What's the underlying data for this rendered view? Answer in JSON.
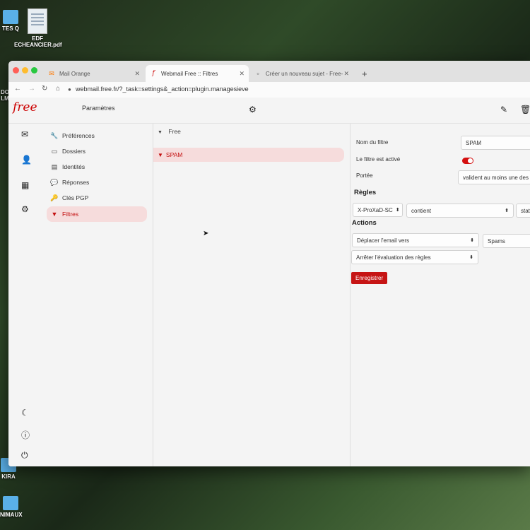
{
  "desktop": {
    "icons": [
      {
        "label": "TES Q"
      },
      {
        "label": "EDF\nECHEANCIER.pdf"
      },
      {
        "label": "DO\nLM"
      },
      {
        "label": "KIRA"
      },
      {
        "label": "NIMAUX"
      }
    ]
  },
  "browser": {
    "tabs": [
      {
        "label": "Mail Orange",
        "icon": "orange-mail-icon"
      },
      {
        "label": "Webmail Free :: Filtres",
        "icon": "free-logo-icon"
      },
      {
        "label": "Créer un nouveau sujet - Free-",
        "icon": "page-icon"
      }
    ],
    "url": "webmail.free.fr/?_task=settings&_action=plugin.managesieve"
  },
  "app": {
    "logo": "free",
    "header_title": "Paramètres",
    "settings_nav": [
      {
        "label": "Préférences",
        "icon": "wrench-icon"
      },
      {
        "label": "Dossiers",
        "icon": "folder-icon"
      },
      {
        "label": "Identités",
        "icon": "id-card-icon"
      },
      {
        "label": "Réponses",
        "icon": "speech-bubble-icon"
      },
      {
        "label": "Clés PGP",
        "icon": "key-icon"
      },
      {
        "label": "Filtres",
        "icon": "filter-icon",
        "active": true
      }
    ],
    "filter_set": "Free",
    "filters": [
      {
        "label": "SPAM"
      }
    ],
    "editor": {
      "filter_name_label": "Nom du filtre",
      "filter_name_value": "SPAM",
      "active_label": "Le filtre est activé",
      "scope_label": "Portée",
      "scope_value": "valident au moins une des",
      "rules_title": "Règles",
      "rule_header": "X-ProXaD-SC",
      "rule_operator": "contient",
      "rule_value": "stat",
      "actions_title": "Actions",
      "action1": "Déplacer l'email vers",
      "action1_target": "Spams",
      "action2": "Arrêter l'évaluation des règles",
      "save_label": "Enregistrer"
    }
  },
  "colors": {
    "accent": "#c61414",
    "active_bg": "#f6dcdc"
  }
}
